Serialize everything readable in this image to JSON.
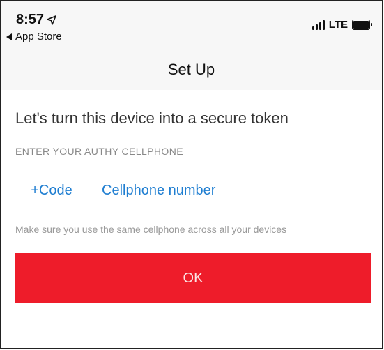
{
  "status_bar": {
    "time": "8:57",
    "back_app": "App Store",
    "network": "LTE"
  },
  "nav": {
    "title": "Set Up"
  },
  "main": {
    "headline": "Let's turn this device into a secure token",
    "section_label": "ENTER YOUR AUTHY CELLPHONE",
    "code_placeholder": "+Code",
    "phone_placeholder": "Cellphone number",
    "hint": "Make sure you use the same cellphone across all your devices",
    "ok_label": "OK"
  },
  "colors": {
    "accent_blue": "#1f7ed1",
    "button_red": "#ee1c2a"
  },
  "icons": [
    "location-arrow-icon",
    "back-triangle-icon",
    "signal-icon",
    "battery-icon"
  ]
}
